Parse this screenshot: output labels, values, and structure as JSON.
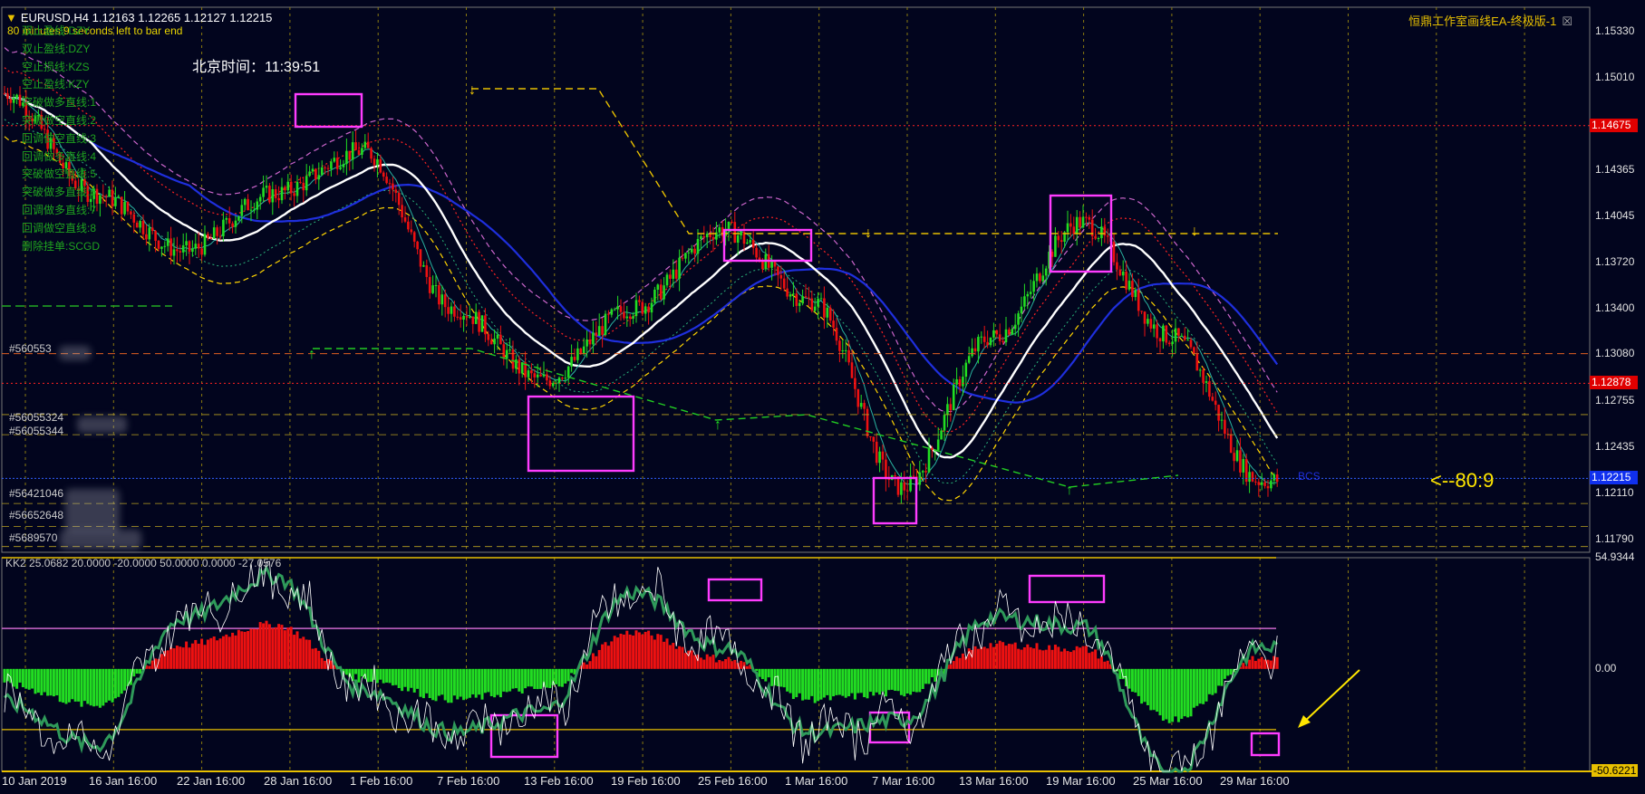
{
  "window": {
    "symbol_line": "EURUSD,H4  1.12163 1.12265 1.12127 1.12215",
    "bar_note": "80 minutes 9 seconds left to bar end",
    "beijing_time": "北京时间：11:39:51",
    "ea_title": "恒鼎工作室画线EA-终极版-1",
    "close_icon": "close-icon",
    "countdown": "<--80:9",
    "bcs_tag": "BCS"
  },
  "legend": [
    "双止盈线:DZY",
    "双止盈线:DZY",
    "空止损线:KZS",
    "空止盈线:KZY",
    "突破做多直线:1",
    "突破做空直线:2",
    "回调做空直线:3",
    "回调做多直线:4",
    "突破做空直线:5",
    "突破做多直线:6",
    "回调做多直线:7",
    "回调做空直线:8",
    "删除挂单:SCGD"
  ],
  "horizontal_labels": [
    "#560553",
    "#56055324",
    "#56055344",
    "#56421046",
    "#56652648",
    "#5689570"
  ],
  "price_axis": {
    "ticks": [
      "1.15330",
      "1.15010",
      "1.14365",
      "1.14045",
      "1.13720",
      "1.13400",
      "1.13080",
      "1.12755",
      "1.12435",
      "1.12110",
      "1.11790"
    ],
    "highlight_red": "1.14675",
    "highlight_red2": "1.12878",
    "highlight_blue": "1.12215"
  },
  "oscillator": {
    "title": "KK2 25.0682 20.0000 -20.0000 50.0000 0.0000 -27.0576",
    "ticks": [
      "54.9344",
      "0.00",
      "-50.6221"
    ]
  },
  "x_axis": [
    "10 Jan 2019",
    "16 Jan 16:00",
    "22 Jan 16:00",
    "28 Jan 16:00",
    "1 Feb 16:00",
    "7 Feb 16:00",
    "13 Feb 16:00",
    "19 Feb 16:00",
    "25 Feb 16:00",
    "1 Mar 16:00",
    "7 Mar 16:00",
    "13 Mar 16:00",
    "19 Mar 16:00",
    "25 Mar 16:00",
    "29 Mar 16:00"
  ],
  "colors": {
    "background": "#02051e",
    "bull": "#22dd22",
    "bear": "#ee1111",
    "ma_white": "#ffffff",
    "ma_blue": "#1f2fdd",
    "env_violet": "#cc66cc",
    "env_red": "#ff2222",
    "env_yellow": "#ffd400",
    "highlight_box": "#ff3cff",
    "signal_line": "#2f9a5a"
  },
  "chart_data": [
    {
      "type": "line",
      "title": "EURUSD,H4",
      "x": [
        "10 Jan 2019",
        "16 Jan 16:00",
        "22 Jan 16:00",
        "28 Jan 16:00",
        "1 Feb 16:00",
        "7 Feb 16:00",
        "13 Feb 16:00",
        "19 Feb 16:00",
        "25 Feb 16:00",
        "1 Mar 16:00",
        "7 Mar 16:00",
        "13 Mar 16:00",
        "19 Mar 16:00",
        "25 Mar 16:00",
        "29 Mar 16:00"
      ],
      "series": [
        {
          "values": [
            1.149,
            1.142,
            1.138,
            1.142,
            1.145,
            1.134,
            1.129,
            1.134,
            1.1395,
            1.1345,
            1.1215,
            1.132,
            1.14,
            1.132,
            1.122
          ]
        }
      ],
      "ylim": [
        1.117,
        1.155
      ]
    },
    {
      "type": "bar",
      "title": "KK2",
      "x": [
        "10 Jan 2019",
        "16 Jan 16:00",
        "22 Jan 16:00",
        "28 Jan 16:00",
        "1 Feb 16:00",
        "7 Feb 16:00",
        "13 Feb 16:00",
        "19 Feb 16:00",
        "25 Feb 16:00",
        "1 Mar 16:00",
        "7 Mar 16:00",
        "13 Mar 16:00",
        "19 Mar 16:00",
        "25 Mar 16:00",
        "29 Mar 16:00"
      ],
      "values": [
        -8,
        -18,
        12,
        22,
        -5,
        -15,
        -10,
        18,
        5,
        -15,
        -12,
        12,
        10,
        -25,
        5
      ],
      "ylim": [
        -50.6221,
        54.9344
      ]
    }
  ]
}
